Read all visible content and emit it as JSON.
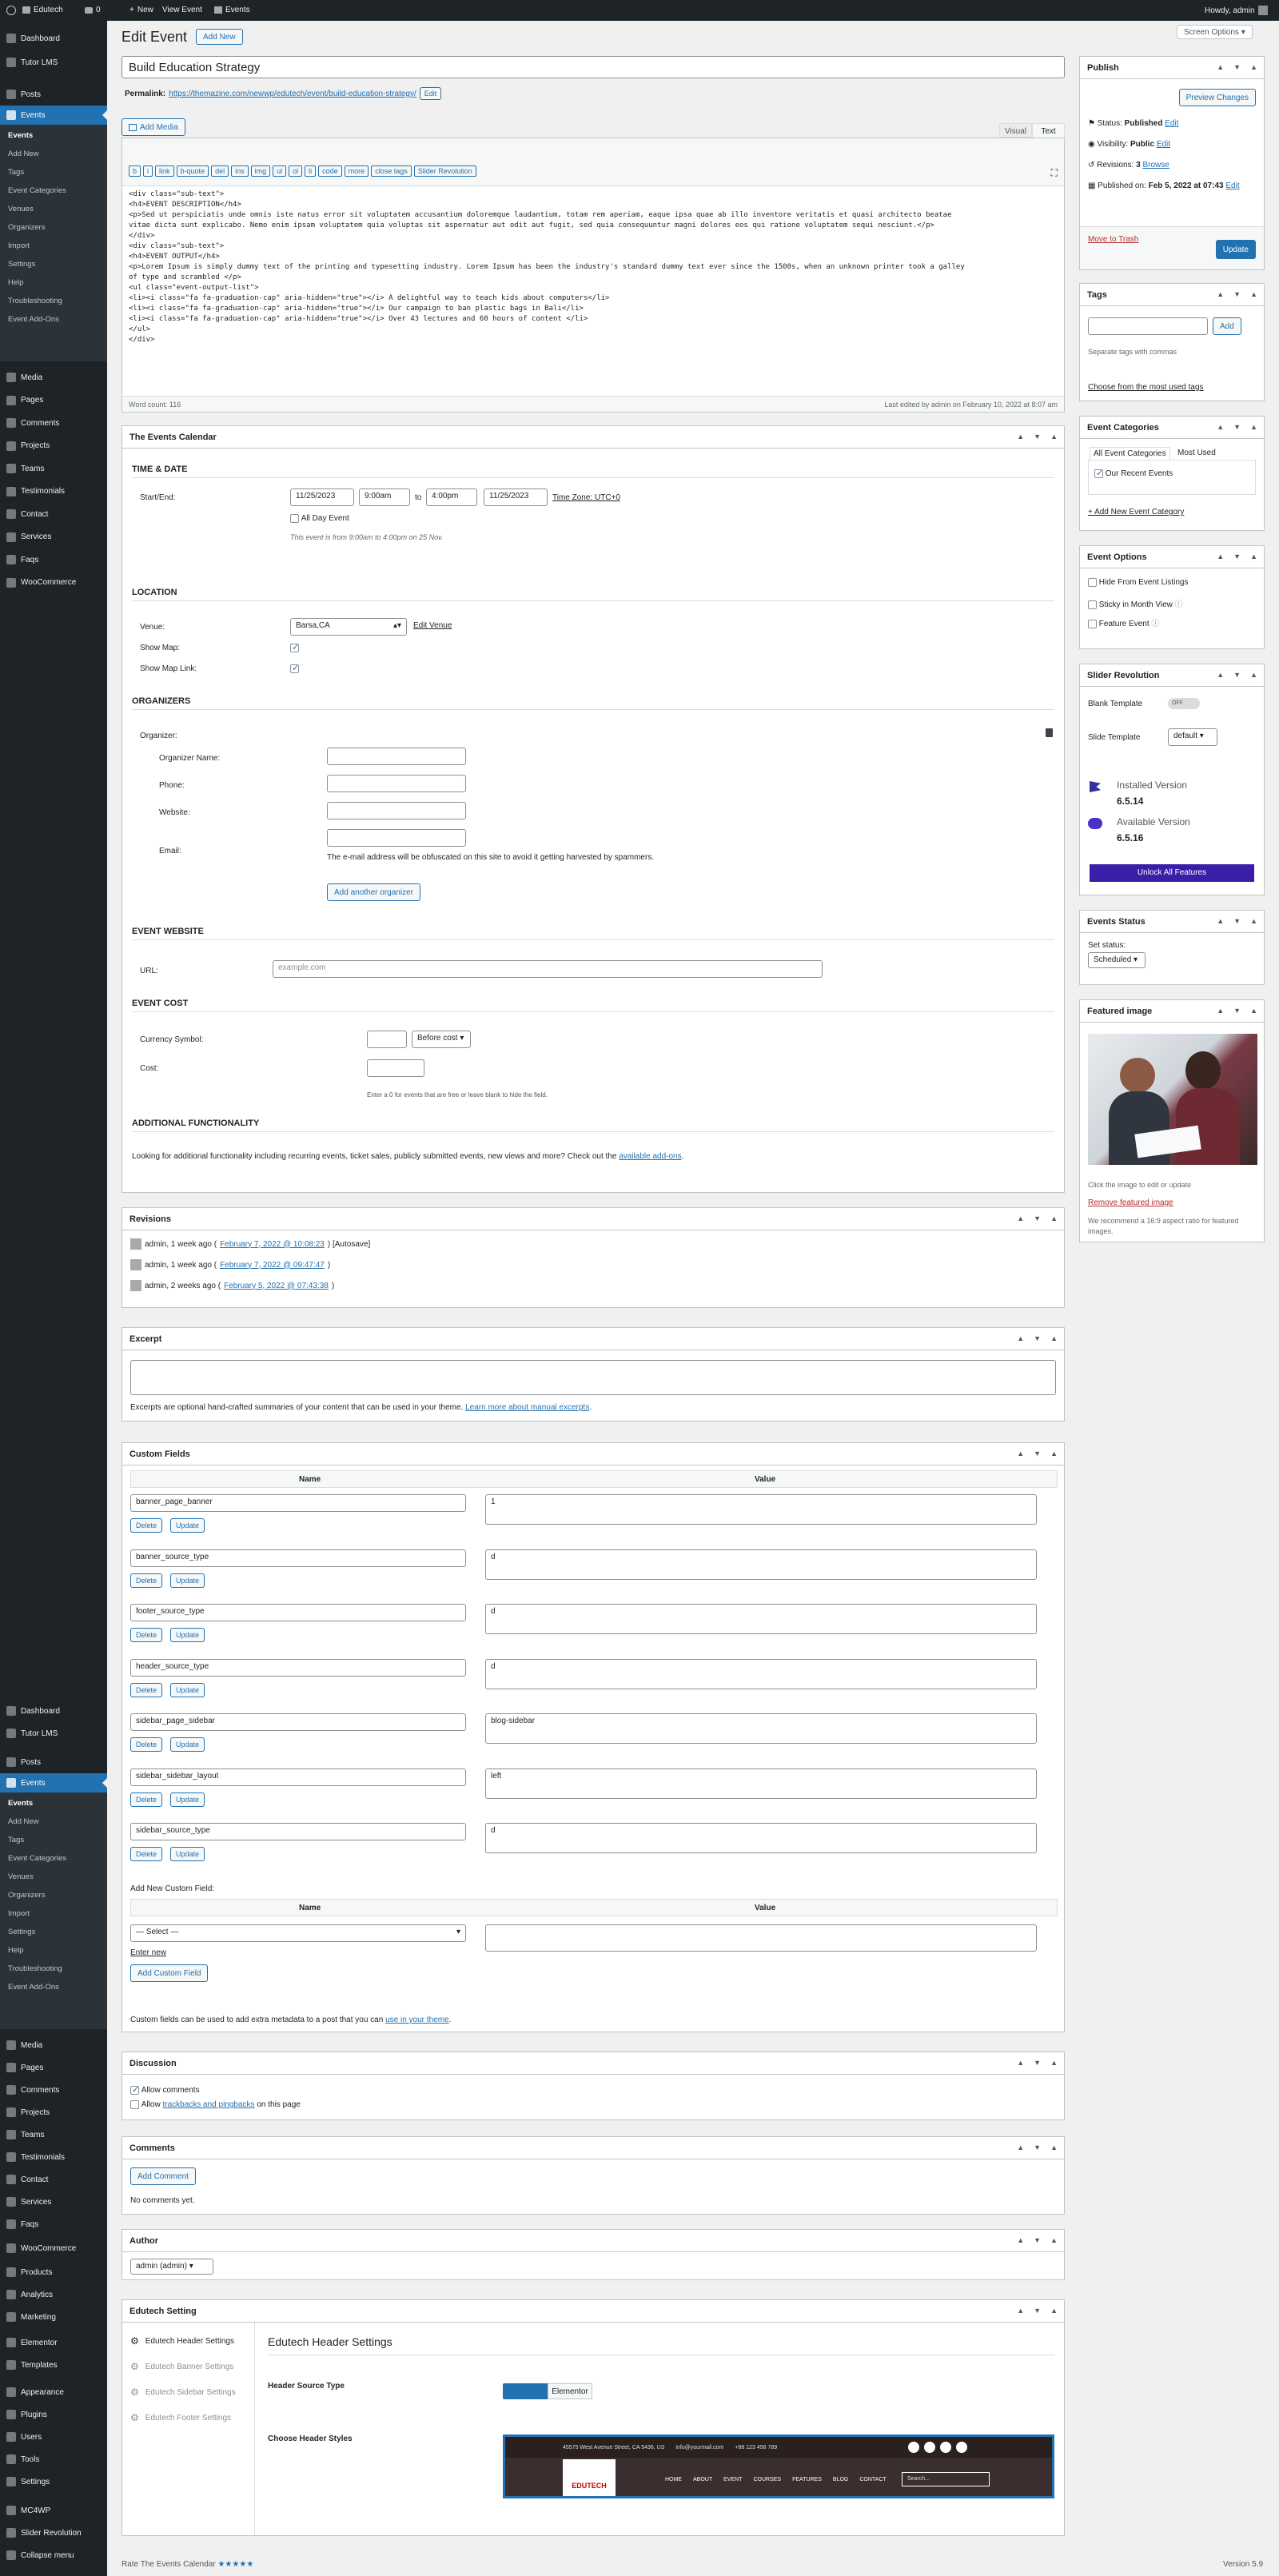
{
  "adminbar": {
    "site": "Edutech",
    "comments": "0",
    "new": "New",
    "view": "View Event",
    "events": "Events",
    "howdy": "Howdy, admin"
  },
  "menu": {
    "top": [
      {
        "label": "Dashboard"
      },
      {
        "label": "Tutor LMS"
      },
      {
        "label": "Posts"
      },
      {
        "label": "Events"
      }
    ],
    "sub": [
      "Events",
      "Add New",
      "Tags",
      "Event Categories",
      "Venues",
      "Organizers",
      "Import",
      "Settings",
      "Help",
      "Troubleshooting",
      "Event Add-Ons"
    ],
    "rest": [
      "Media",
      "Pages",
      "Comments",
      "Projects",
      "Teams",
      "Testimonials",
      "Contact",
      "Services",
      "Faqs",
      "WooCommerce"
    ],
    "rest2": [
      "Media",
      "Pages",
      "Comments",
      "Projects",
      "Teams",
      "Testimonials",
      "Contact",
      "Services",
      "Faqs",
      "WooCommerce",
      "Products",
      "Analytics",
      "Marketing",
      "Elementor",
      "Templates",
      "Appearance",
      "Plugins",
      "Users",
      "Tools",
      "Settings",
      "MC4WP",
      "Slider Revolution",
      "Collapse menu"
    ]
  },
  "screen_options": "Screen Options",
  "page_title": "Edit Event",
  "add_new": "Add New",
  "post_title": "Build Education Strategy",
  "permalink": {
    "label": "Permalink:",
    "url": "https://themazine.com/newwp/edutech/event/build-education-strategy/",
    "edit": "Edit"
  },
  "editor": {
    "add_media": "Add Media",
    "tab_visual": "Visual",
    "tab_text": "Text",
    "qt": [
      "b",
      "i",
      "link",
      "b-quote",
      "del",
      "ins",
      "img",
      "ul",
      "ol",
      "li",
      "code",
      "more",
      "close tags",
      "Slider Revolution"
    ],
    "content": "<div class=\"sub-text\">\n<h4>EVENT DESCRIPTION</h4>\n<p>Sed ut perspiciatis unde omnis iste natus error sit voluptatem accusantium doloremque laudantium, totam rem aperiam, eaque ipsa quae ab illo inventore veritatis et quasi architecto beatae\nvitae dicta sunt explicabo. Nemo enim ipsam voluptatem quia voluptas sit aspernatur aut odit aut fugit, sed quia consequuntur magni dolores eos qui ratione voluptatem sequi nesciunt.</p>\n</div>\n<div class=\"sub-text\">\n<h4>EVENT OUTPUT</h4>\n<p>Lorem Ipsum is simply dummy text of the printing and typesetting industry. Lorem Ipsum has been the industry's standard dummy text ever since the 1500s, when an unknown printer took a galley\nof type and scrambled </p>\n<ul class=\"event-output-list\">\n<li><i class=\"fa fa-graduation-cap\" aria-hidden=\"true\"></i> A delightful way to teach kids about computers</li>\n<li><i class=\"fa fa-graduation-cap\" aria-hidden=\"true\"></i> Our campaign to ban plastic bags in Bali</li>\n<li><i class=\"fa fa-graduation-cap\" aria-hidden=\"true\"></i> Over 43 lectures and 60 hours of content </li>\n</ul>\n</div>",
    "word_count": "Word count: 116",
    "last_edited": "Last edited by admin on February 10, 2022 at 8:07 am"
  },
  "tec": {
    "title": "The Events Calendar",
    "time_date": "TIME & DATE",
    "start_end": "Start/End:",
    "start_date": "11/25/2023",
    "start_time": "9:00am",
    "to": "to",
    "end_time": "4:00pm",
    "end_date": "11/25/2023",
    "tz": "Time Zone: UTC+0",
    "all_day": "All Day Event",
    "note": "This event is from 9:00am to 4:00pm on 25 Nov.",
    "location": "LOCATION",
    "venue_label": "Venue:",
    "venue": "Barsa,CA",
    "edit_venue": "Edit Venue",
    "show_map": "Show Map:",
    "show_map_link": "Show Map Link:",
    "organizers": "ORGANIZERS",
    "organizer": "Organizer:",
    "org_name": "Organizer Name:",
    "phone": "Phone:",
    "website": "Website:",
    "email": "Email:",
    "email_note": "The e-mail address will be obfuscated on this site to avoid it getting harvested by spammers.",
    "add_org": "Add another organizer",
    "event_website": "EVENT WEBSITE",
    "url": "URL:",
    "url_placeholder": "example.com",
    "event_cost": "EVENT COST",
    "currency": "Currency Symbol:",
    "before_cost": "Before cost",
    "cost": "Cost:",
    "cost_note": "Enter a 0 for events that are free or leave blank to hide the field.",
    "additional": "ADDITIONAL FUNCTIONALITY",
    "additional_text": "Looking for additional functionality including recurring events, ticket sales, publicly submitted events, new views and more? Check out the",
    "addons": "available add-ons"
  },
  "revisions": {
    "title": "Revisions",
    "items": [
      {
        "who": "admin, 1 week ago (",
        "link": "February 7, 2022 @ 10:08:23",
        "after": ") [Autosave]"
      },
      {
        "who": "admin, 1 week ago (",
        "link": "February 7, 2022 @ 09:47:47",
        "after": ")"
      },
      {
        "who": "admin, 2 weeks ago (",
        "link": "February 5, 2022 @ 07:43:38",
        "after": ")"
      }
    ]
  },
  "excerpt": {
    "title": "Excerpt",
    "help": "Excerpts are optional hand-crafted summaries of your content that can be used in your theme.",
    "link": "Learn more about manual excerpts"
  },
  "custom_fields": {
    "title": "Custom Fields",
    "name": "Name",
    "value": "Value",
    "delete": "Delete",
    "update": "Update",
    "rows": [
      {
        "name": "banner_page_banner",
        "value": "1"
      },
      {
        "name": "banner_source_type",
        "value": "d"
      },
      {
        "name": "footer_source_type",
        "value": "d"
      },
      {
        "name": "header_source_type",
        "value": "d"
      },
      {
        "name": "sidebar_page_sidebar",
        "value": "blog-sidebar"
      },
      {
        "name": "sidebar_sidebar_layout",
        "value": "left"
      },
      {
        "name": "sidebar_source_type",
        "value": "d"
      }
    ],
    "add_new": "Add New Custom Field:",
    "select": "— Select —",
    "enter_new": "Enter new",
    "add_btn": "Add Custom Field",
    "help": "Custom fields can be used to add extra metadata to a post that you can",
    "help_link": "use in your theme"
  },
  "discussion": {
    "title": "Discussion",
    "allow_comments": "Allow comments",
    "allow": "Allow",
    "trackbacks": "trackbacks and pingbacks",
    "on_page": "on this page"
  },
  "comments": {
    "title": "Comments",
    "add": "Add Comment",
    "none": "No comments yet."
  },
  "author": {
    "title": "Author",
    "value": "admin (admin)"
  },
  "edutech": {
    "title": "Edutech Setting",
    "tabs": [
      "Edutech Header Settings",
      "Edutech Banner Settings",
      "Edutech Sidebar Settings",
      "Edutech Footer Settings"
    ],
    "heading": "Edutech Header Settings",
    "source_type": "Header Source Type",
    "elementor": "Elementor",
    "choose": "Choose Header Styles",
    "preview": {
      "addr": "45575 West Avenue Street, CA 5436, US",
      "mail": "info@yourmail.com",
      "phone": "+88 123 456 789",
      "logo": "EDUTECH",
      "nav": [
        "HOME",
        "ABOUT",
        "EVENT",
        "COURSES",
        "FEATURES",
        "BLOG",
        "CONTACT"
      ],
      "search": "Search..."
    }
  },
  "publish": {
    "title": "Publish",
    "preview": "Preview Changes",
    "status": "Status:",
    "status_v": "Published",
    "edit": "Edit",
    "visibility": "Visibility:",
    "visibility_v": "Public",
    "revisions": "Revisions:",
    "rev_n": "3",
    "browse": "Browse",
    "published": "Published on:",
    "published_v": "Feb 5, 2022 at 07:43",
    "trash": "Move to Trash",
    "update": "Update"
  },
  "tags": {
    "title": "Tags",
    "add": "Add",
    "sep": "Separate tags with commas",
    "choose": "Choose from the most used tags"
  },
  "event_categories": {
    "title": "Event Categories",
    "tab_all": "All Event Categories",
    "tab_most": "Most Used",
    "item": "Our Recent Events",
    "add": "+ Add New Event Category"
  },
  "event_options": {
    "title": "Event Options",
    "hide": "Hide From Event Listings",
    "sticky": "Sticky in Month View",
    "feature": "Feature Event"
  },
  "slider_rev": {
    "title": "Slider Revolution",
    "blank": "Blank Template",
    "off": "OFF",
    "slide_tpl": "Slide Template",
    "default": "default",
    "installed": "Installed Version",
    "installed_v": "6.5.14",
    "available": "Available Version",
    "available_v": "6.5.16",
    "unlock": "Unlock All Features"
  },
  "events_status": {
    "title": "Events Status",
    "set": "Set status:",
    "value": "Scheduled"
  },
  "featured": {
    "title": "Featured image",
    "click": "Click the image to edit or update",
    "remove": "Remove featured image",
    "rec": "We recommend a 16:9 aspect ratio for featured images."
  },
  "footer": {
    "rate": "Rate The Events Calendar",
    "stars": "★★★★★",
    "version": "Version 5.9"
  }
}
